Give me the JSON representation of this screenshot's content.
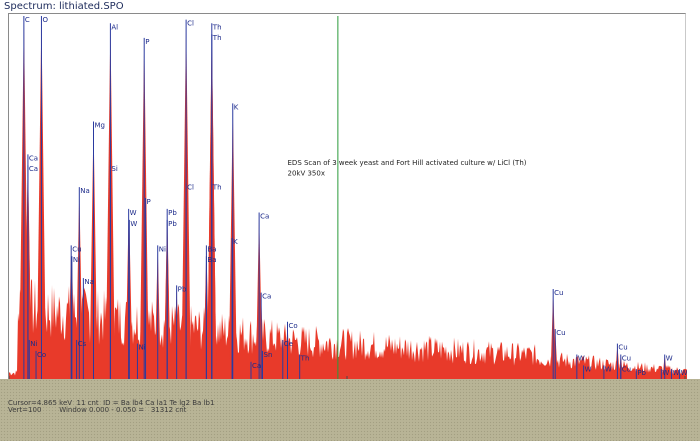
{
  "window": {
    "title": "Spectrum: lithiated.SPO"
  },
  "status": {
    "cursor_line": "Cursor=4.865 keV  11 cnt  ID = Ba lb4 Ca la1 Te lg2 Ba lb1",
    "vert_line": "Vert=100        Window 0.000 - 0.050 =   31312 cnt"
  },
  "colors": {
    "spectrum": "#e83a2a",
    "marker": "#2a3aa0",
    "cursor": "#2a9a3a",
    "axis": "#4a4a4a"
  },
  "chart_data": {
    "type": "bar",
    "title": "",
    "xlabel": "",
    "ylabel": "",
    "xlim": [
      0,
      10
    ],
    "ylim": [
      0,
      100
    ],
    "xticks": [
      "0",
      "5",
      "10"
    ],
    "cursor_kev": 4.865,
    "annotation": [
      "EDS Scan of 3 week yeast and Fort Hill activated culture w/ LiCl (Th)",
      "20kV 350x"
    ],
    "peaks": [
      {
        "x": 0.22,
        "y": 100,
        "label": "C"
      },
      {
        "x": 0.48,
        "y": 100,
        "label": "O"
      },
      {
        "x": 1.5,
        "y": 98,
        "label": "Al"
      },
      {
        "x": 2.0,
        "y": 94,
        "label": "P"
      },
      {
        "x": 2.62,
        "y": 99,
        "label": "Cl"
      },
      {
        "x": 3.0,
        "y": 98,
        "label": "Th"
      },
      {
        "x": 3.0,
        "y": 95,
        "label": "Th"
      },
      {
        "x": 3.31,
        "y": 76,
        "label": "K"
      },
      {
        "x": 1.25,
        "y": 71,
        "label": "Mg"
      },
      {
        "x": 1.5,
        "y": 59,
        "label": "Si"
      },
      {
        "x": 0.28,
        "y": 62,
        "label": "Ca"
      },
      {
        "x": 0.28,
        "y": 59,
        "label": "Ca"
      },
      {
        "x": 1.04,
        "y": 53,
        "label": "Na"
      },
      {
        "x": 2.62,
        "y": 54,
        "label": "Cl"
      },
      {
        "x": 3.0,
        "y": 54,
        "label": "Th"
      },
      {
        "x": 2.02,
        "y": 50,
        "label": "P"
      },
      {
        "x": 1.77,
        "y": 47,
        "label": "W"
      },
      {
        "x": 1.78,
        "y": 44,
        "label": "W"
      },
      {
        "x": 2.34,
        "y": 47,
        "label": "Pb"
      },
      {
        "x": 2.34,
        "y": 44,
        "label": "Pb"
      },
      {
        "x": 3.7,
        "y": 46,
        "label": "Ca"
      },
      {
        "x": 3.3,
        "y": 39,
        "label": "K"
      },
      {
        "x": 0.92,
        "y": 37,
        "label": "Cu"
      },
      {
        "x": 2.2,
        "y": 37,
        "label": "Ni"
      },
      {
        "x": 2.92,
        "y": 37,
        "label": "Ba"
      },
      {
        "x": 2.92,
        "y": 34,
        "label": "Ba"
      },
      {
        "x": 0.93,
        "y": 34,
        "label": "Ni"
      },
      {
        "x": 1.1,
        "y": 28,
        "label": "Na"
      },
      {
        "x": 2.48,
        "y": 26,
        "label": "Pb"
      },
      {
        "x": 3.73,
        "y": 24,
        "label": "Ca"
      },
      {
        "x": 8.05,
        "y": 25,
        "label": "Cu"
      },
      {
        "x": 8.08,
        "y": 14,
        "label": "Cu"
      },
      {
        "x": 9.0,
        "y": 10,
        "label": "Cu"
      },
      {
        "x": 9.05,
        "y": 7,
        "label": "Cu"
      },
      {
        "x": 8.4,
        "y": 7,
        "label": "W"
      },
      {
        "x": 9.7,
        "y": 7,
        "label": "W"
      },
      {
        "x": 9.05,
        "y": 4,
        "label": "Cu"
      },
      {
        "x": 8.5,
        "y": 4,
        "label": "W"
      },
      {
        "x": 8.8,
        "y": 4,
        "label": "W"
      },
      {
        "x": 9.28,
        "y": 3,
        "label": "Pb"
      },
      {
        "x": 9.65,
        "y": 3,
        "label": "W"
      },
      {
        "x": 9.8,
        "y": 3,
        "label": "W"
      },
      {
        "x": 9.92,
        "y": 3,
        "label": "W"
      },
      {
        "x": 4.12,
        "y": 16,
        "label": "Co"
      },
      {
        "x": 4.05,
        "y": 11,
        "label": "Ce"
      },
      {
        "x": 4.3,
        "y": 7,
        "label": "Th"
      },
      {
        "x": 0.3,
        "y": 11,
        "label": "Ni"
      },
      {
        "x": 0.4,
        "y": 8,
        "label": "Co"
      },
      {
        "x": 1.0,
        "y": 11,
        "label": "Cs"
      },
      {
        "x": 1.9,
        "y": 10,
        "label": "Ni"
      },
      {
        "x": 3.75,
        "y": 8,
        "label": "Sn"
      },
      {
        "x": 3.58,
        "y": 5,
        "label": "Ca"
      }
    ]
  }
}
